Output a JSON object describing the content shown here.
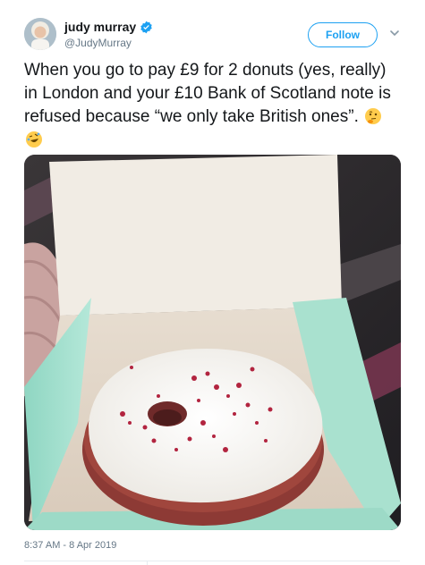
{
  "author": {
    "display_name": "judy murray",
    "handle": "@JudyMurray",
    "verified": true
  },
  "actions": {
    "follow_label": "Follow"
  },
  "tweet": {
    "text": "When you go to pay £9 for 2 donuts (yes, really) in London and your £10 Bank of Scotland note is refused because “we only take British ones”. ",
    "emojis": [
      "thinking-face",
      "rolling-on-floor-laughing"
    ],
    "timestamp": "8:37 AM - 8 Apr 2019"
  },
  "colors": {
    "brand": "#1da1f2",
    "text": "#14171a",
    "muted": "#657786"
  }
}
